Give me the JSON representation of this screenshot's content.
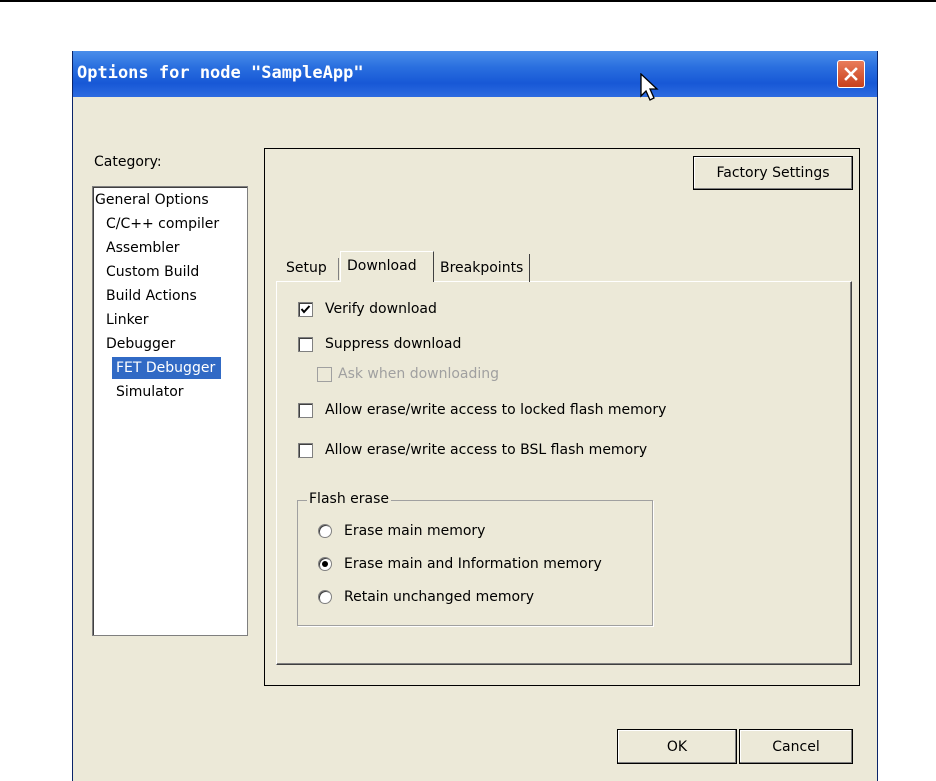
{
  "window": {
    "title": "Options for node \"SampleApp\""
  },
  "category": {
    "label": "Category:",
    "items": [
      {
        "label": "General Options",
        "indent": 0
      },
      {
        "label": "C/C++ compiler",
        "indent": 1
      },
      {
        "label": "Assembler",
        "indent": 1
      },
      {
        "label": "Custom Build",
        "indent": 1
      },
      {
        "label": "Build Actions",
        "indent": 1
      },
      {
        "label": "Linker",
        "indent": 1
      },
      {
        "label": "Debugger",
        "indent": 1
      },
      {
        "label": "FET Debugger",
        "indent": 2,
        "selected": true
      },
      {
        "label": "Simulator",
        "indent": 2
      }
    ]
  },
  "panel": {
    "factory_settings": "Factory Settings",
    "tabs": [
      {
        "label": "Setup"
      },
      {
        "label": "Download",
        "active": true
      },
      {
        "label": "Breakpoints"
      }
    ],
    "download": {
      "verify": {
        "label": "Verify download",
        "checked": true
      },
      "suppress": {
        "label": "Suppress download",
        "checked": false
      },
      "ask": {
        "label": "Ask when downloading",
        "checked": false,
        "disabled": true
      },
      "locked_flash": {
        "label": "Allow erase/write access to locked flash memory",
        "checked": false
      },
      "bsl_flash": {
        "label": "Allow erase/write access to BSL flash memory",
        "checked": false
      },
      "flash_erase": {
        "label": "Flash erase",
        "options": [
          {
            "label": "Erase main memory",
            "selected": false
          },
          {
            "label": "Erase main and Information memory",
            "selected": true
          },
          {
            "label": "Retain unchanged memory",
            "selected": false
          }
        ]
      }
    }
  },
  "buttons": {
    "ok": "OK",
    "cancel": "Cancel"
  },
  "colors": {
    "titlebar": "#1758d6",
    "dialog_bg": "#ece9d8",
    "selection": "#316ac5",
    "close": "#c8401c"
  },
  "icons": {
    "close": "close-icon",
    "cursor": "mouse-pointer-icon",
    "check": "check-icon"
  }
}
